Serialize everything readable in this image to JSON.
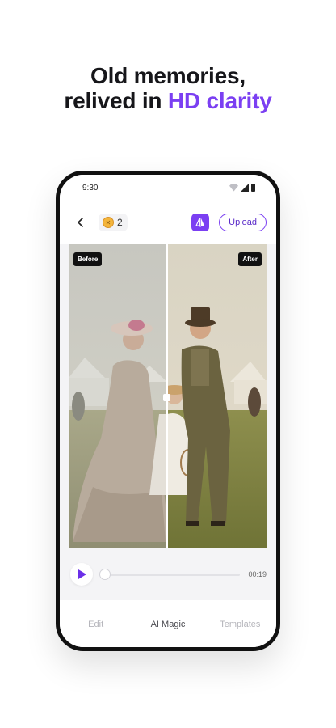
{
  "headline": {
    "line1": "Old memories,",
    "line2_plain": "relived in ",
    "line2_accent": "HD clarity",
    "accent_color": "#7b3ff2"
  },
  "status_bar": {
    "time": "9:30",
    "icons": [
      "wifi-icon",
      "signal-icon",
      "battery-icon"
    ]
  },
  "top_bar": {
    "back_icon": "chevron-left-icon",
    "credit_icon": "coin-icon",
    "credits": "2",
    "compare_icon": "compare-split-icon",
    "upload_label": "Upload"
  },
  "preview": {
    "before_label": "Before",
    "after_label": "After"
  },
  "player": {
    "play_icon": "play-icon",
    "duration": "00:19",
    "progress": 0
  },
  "tabs": [
    {
      "label": "Edit",
      "active": false
    },
    {
      "label": "AI Magic",
      "active": true
    },
    {
      "label": "Templates",
      "active": false
    }
  ]
}
